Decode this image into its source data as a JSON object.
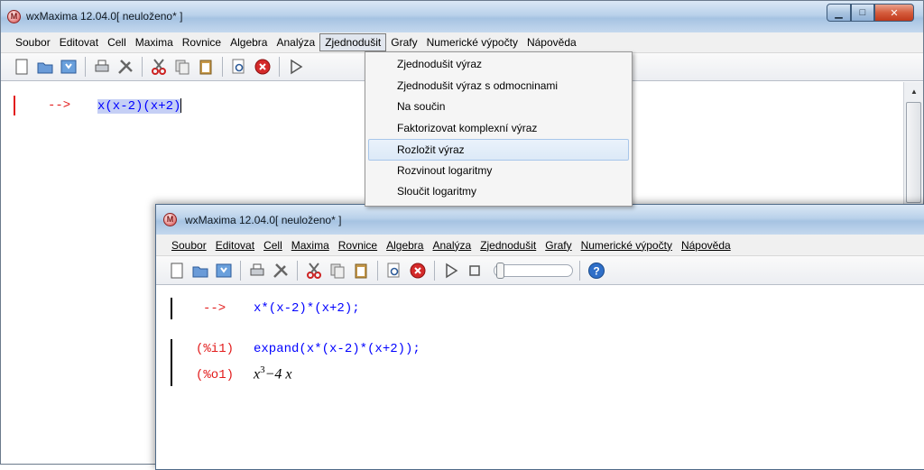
{
  "back_window": {
    "title": "wxMaxima 12.04.0[ neuloženo* ]",
    "menu": [
      "Soubor",
      "Editovat",
      "Cell",
      "Maxima",
      "Rovnice",
      "Algebra",
      "Analýza",
      "Zjednodušit",
      "Grafy",
      "Numerické výpočty",
      "Nápověda"
    ],
    "active_menu": "Zjednodušit",
    "cell": {
      "prompt": "-->",
      "input": "x(x-2)(x+2)"
    },
    "dropdown_items": [
      "Zjednodušit výraz",
      "Zjednodušit výraz s odmocninami",
      "Na součin",
      "Faktorizovat komplexní výraz",
      "Rozložit výraz",
      "Rozvinout logaritmy",
      "Sloučit logaritmy"
    ],
    "hovered_item": "Rozložit výraz"
  },
  "front_window": {
    "title": "wxMaxima 12.04.0[ neuloženo* ]",
    "menu": [
      "Soubor",
      "Editovat",
      "Cell",
      "Maxima",
      "Rovnice",
      "Algebra",
      "Analýza",
      "Zjednodušit",
      "Grafy",
      "Numerické výpočty",
      "Nápověda"
    ],
    "cell1": {
      "prompt": "-->",
      "input": "x*(x-2)*(x+2);"
    },
    "cell2": {
      "input_label": "(%i1)",
      "input": "expand(x*(x-2)*(x+2));",
      "output_label": "(%o1)",
      "output_base": "x",
      "output_exp": "3",
      "output_rest": "−4 x"
    }
  },
  "colors": {
    "prompt": "#e21b1b",
    "input": "#0000ff",
    "hover": "#dce9f7",
    "selection": "#c5cff5"
  }
}
